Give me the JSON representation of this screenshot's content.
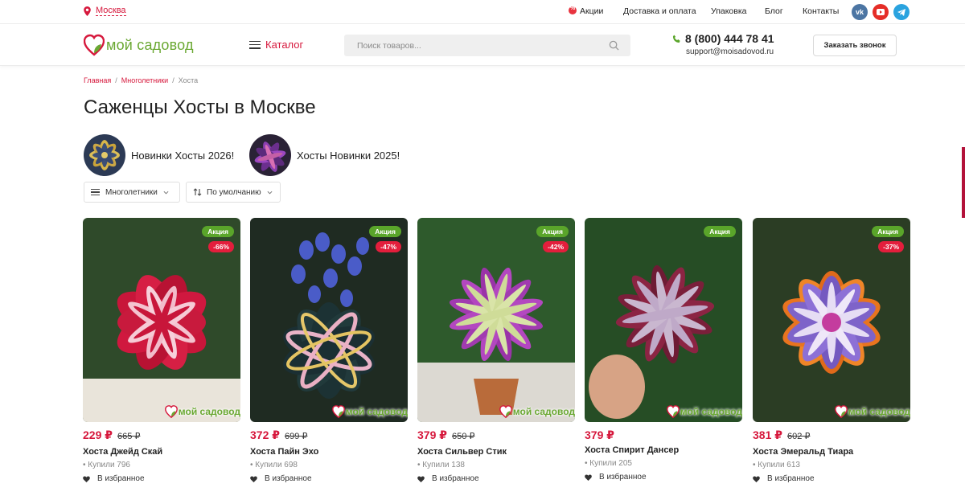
{
  "topbar": {
    "city": "Москва",
    "nav": [
      "Акции",
      "Доставка и оплата",
      "Упаковка",
      "Блог",
      "Контакты"
    ],
    "social": [
      "vk-icon",
      "youtube-icon",
      "telegram-icon"
    ]
  },
  "header": {
    "logo_text": "мой садовод",
    "catalog_label": "Каталог",
    "search_placeholder": "Поиск товаров...",
    "phone": "8 (800) 444 78 41",
    "email": "support@moisadovod.ru",
    "callback_label": "Заказать звонок"
  },
  "breadcrumb": [
    "Главная",
    "Многолетники",
    "Хоста"
  ],
  "page_title": "Саженцы Хосты в Москве",
  "collections": [
    {
      "label": "Новинки Хосты 2026!"
    },
    {
      "label": "Хосты Новинки 2025!"
    }
  ],
  "filters": {
    "category": "Многолетники",
    "sort": "По умолчанию"
  },
  "product_common": {
    "sale_badge": "Акция",
    "favorite_label": "В избранное",
    "watermark": "мой садовод"
  },
  "products": [
    {
      "name": "Хоста Джейд Скай",
      "price": "229 ₽",
      "old_price": "665 ₽",
      "discount": "-66%",
      "bought": "Купили 796",
      "has_discount": true
    },
    {
      "name": "Хоста Пайн Эхо",
      "price": "372 ₽",
      "old_price": "699 ₽",
      "discount": "-47%",
      "bought": "Купили 698",
      "has_discount": true
    },
    {
      "name": "Хоста Сильвер Стик",
      "price": "379 ₽",
      "old_price": "650 ₽",
      "discount": "-42%",
      "bought": "Купили 138",
      "has_discount": true
    },
    {
      "name": "Хоста Спирит Дансер",
      "price": "379 ₽",
      "old_price": "",
      "discount": "",
      "bought": "Купили 205",
      "has_discount": false
    },
    {
      "name": "Хоста Эмеральд Тиара",
      "price": "381 ₽",
      "old_price": "602 ₽",
      "discount": "-37%",
      "bought": "Купили 613",
      "has_discount": true
    }
  ],
  "colors": {
    "accent": "#d6183c",
    "brand_green": "#6aa832",
    "sale_green": "#5aa52a",
    "discount_red": "#e31e3c"
  }
}
